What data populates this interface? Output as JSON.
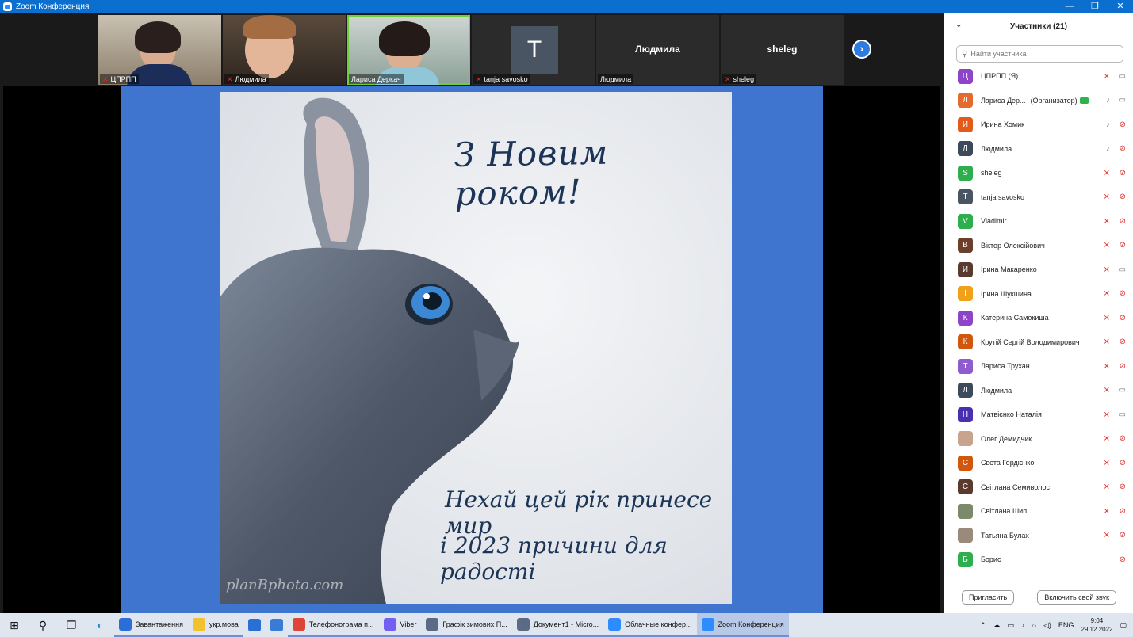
{
  "window": {
    "title": "Zoom Конференция",
    "controls": [
      "—",
      "❐",
      "✕"
    ]
  },
  "video_strip": {
    "tiles": [
      {
        "name": "ЦПРПП",
        "muted": true
      },
      {
        "name": "Людмила",
        "muted": true
      },
      {
        "name": "Лариса Деркач",
        "muted": false
      },
      {
        "name": "tanja savosko",
        "muted": true,
        "avatar": "T"
      },
      {
        "name": "Людмила",
        "muted": false,
        "big": "Людмила"
      },
      {
        "name": "sheleg",
        "muted": true,
        "big": "sheleg"
      }
    ],
    "next_icon": "›"
  },
  "slide": {
    "title": "З Новим роком!",
    "line1": "Нехай цей рік принесе мир",
    "line2": "і 2023 причини для радості",
    "watermark": "planBphoto.com",
    "bg_color": "#3f74cf"
  },
  "participants": {
    "header": "Участники (21)",
    "search_placeholder": "Найти участника",
    "items": [
      {
        "initial": "Ц",
        "color": "#8e44c9",
        "name": "ЦПРПП (Я)",
        "mic": "off",
        "cam": "on"
      },
      {
        "initial": "Л",
        "color": "#e46a2e",
        "name": "Лариса Дер...",
        "role": "(Организатор)",
        "mic": "on",
        "cam": "on"
      },
      {
        "initial": "И",
        "color": "#e35a1b",
        "name": "Ирина Хомик",
        "mic": "on",
        "cam": "off"
      },
      {
        "initial": "Л",
        "color": "#3d4a5c",
        "name": "Людмила",
        "mic": "on",
        "cam": "off"
      },
      {
        "initial": "S",
        "color": "#2fae4e",
        "name": "sheleg",
        "mic": "off",
        "cam": "off"
      },
      {
        "initial": "T",
        "color": "#4a5564",
        "name": "tanja savosko",
        "mic": "off",
        "cam": "off"
      },
      {
        "initial": "V",
        "color": "#2fae4e",
        "name": "Vladimir",
        "mic": "off",
        "cam": "off"
      },
      {
        "initial": "В",
        "color": "#6b3f2a",
        "name": "Віктор Олексійович",
        "mic": "off",
        "cam": "off"
      },
      {
        "initial": "И",
        "color": "#5b3a2e",
        "name": "Ірина Макаренко",
        "mic": "off",
        "cam": "on"
      },
      {
        "initial": "І",
        "color": "#f0a019",
        "name": "Ірина Шукшина",
        "mic": "off",
        "cam": "off"
      },
      {
        "initial": "К",
        "color": "#8e44c9",
        "name": "Катерина Самокиша",
        "mic": "off",
        "cam": "off"
      },
      {
        "initial": "К",
        "color": "#d2570e",
        "name": "Крутій Сергій Володимирович",
        "mic": "off",
        "cam": "off"
      },
      {
        "initial": "Т",
        "color": "#8e5ccf",
        "name": "Лариса Трухан",
        "mic": "off",
        "cam": "off"
      },
      {
        "initial": "Л",
        "color": "#3d4a5c",
        "name": "Людмила",
        "mic": "off",
        "cam": "on"
      },
      {
        "initial": "Н",
        "color": "#4b2fb3",
        "name": "Матвієнко Наталія",
        "mic": "off",
        "cam": "on"
      },
      {
        "initial": "",
        "color": "#c9a48c",
        "name": "Олег Демидчик",
        "mic": "off",
        "cam": "off"
      },
      {
        "initial": "С",
        "color": "#d2570e",
        "name": "Света Гордієнко",
        "mic": "off",
        "cam": "off"
      },
      {
        "initial": "С",
        "color": "#5b3a2e",
        "name": "Світлана Семиволос",
        "mic": "off",
        "cam": "off"
      },
      {
        "initial": "",
        "color": "#7a8a6b",
        "name": "Світлана Шип",
        "mic": "off",
        "cam": "off"
      },
      {
        "initial": "",
        "color": "#9a8a7a",
        "name": "Татьяна Булах",
        "mic": "off",
        "cam": "off"
      },
      {
        "initial": "Б",
        "color": "#2fae4e",
        "name": "Борис",
        "mic": "none",
        "cam": "off"
      }
    ],
    "invite_label": "Пригласить",
    "unmute_label": "Включить свой звук"
  },
  "taskbar": {
    "apps": [
      {
        "label": "Завантаження",
        "color": "#2a6fd6"
      },
      {
        "label": "укр.мова",
        "color": "#f2c12e"
      },
      {
        "label": "",
        "color": "#2a6fd6"
      },
      {
        "label": "",
        "color": "#3a7bd5"
      },
      {
        "label": "Телефонограма п...",
        "color": "#db4437"
      },
      {
        "label": "Viber",
        "color": "#7360f2"
      },
      {
        "label": "Графік зимових П...",
        "color": "#5a6b85"
      },
      {
        "label": "Документ1 - Micro...",
        "color": "#5a6b85"
      },
      {
        "label": "Облачные конфер...",
        "color": "#2d8cff"
      },
      {
        "label": "Zoom Конференция",
        "color": "#2d8cff"
      }
    ],
    "lang": "ENG",
    "time": "9:04",
    "date": "29.12.2022"
  }
}
